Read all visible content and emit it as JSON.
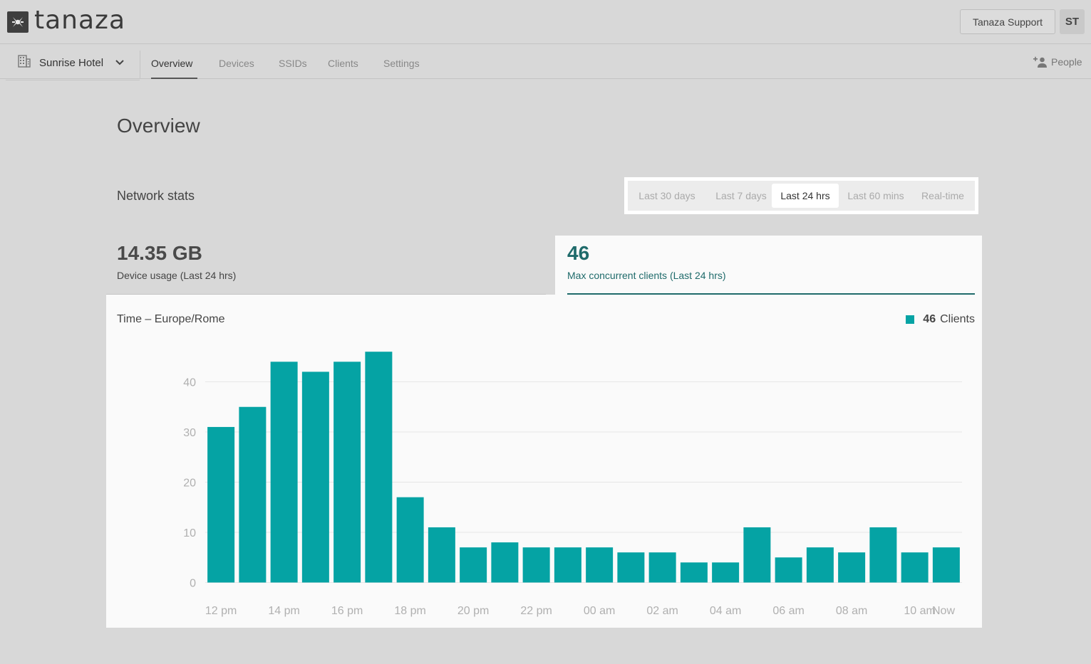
{
  "header": {
    "logo_text": "tanaza",
    "support_label": "Tanaza Support",
    "avatar_initials": "ST"
  },
  "nav": {
    "site_name": "Sunrise Hotel",
    "tabs": [
      {
        "label": "Overview",
        "active": true
      },
      {
        "label": "Devices",
        "active": false
      },
      {
        "label": "SSIDs",
        "active": false
      },
      {
        "label": "Clients",
        "active": false
      },
      {
        "label": "Settings",
        "active": false
      }
    ],
    "people_label": "People"
  },
  "page": {
    "title": "Overview",
    "section_title": "Network stats"
  },
  "range": {
    "options": [
      "Last 30 days",
      "Last 7 days",
      "Last 24 hrs",
      "Last 60 mins",
      "Real-time"
    ],
    "selected": "Last 24 hrs"
  },
  "stats": {
    "usage_value": "14.35 GB",
    "usage_label": "Device usage (Last 24 hrs)",
    "clients_value": "46",
    "clients_label": "Max concurrent clients (Last 24 hrs)"
  },
  "chart": {
    "timezone_label": "Time – Europe/Rome",
    "legend_count": "46",
    "legend_label": "Clients"
  },
  "colors": {
    "bar": "#05a3a4",
    "accent": "#1f6b6b"
  },
  "chart_data": {
    "type": "bar",
    "series": [
      {
        "name": "Clients",
        "values": [
          31,
          35,
          44,
          42,
          44,
          46,
          17,
          11,
          7,
          8,
          7,
          7,
          7,
          6,
          6,
          4,
          4,
          11,
          5,
          7,
          6,
          11,
          6,
          7
        ]
      }
    ],
    "x_tick_labels": [
      "12 pm",
      "14 pm",
      "16 pm",
      "18 pm",
      "20 pm",
      "22 pm",
      "00 am",
      "02 am",
      "04 am",
      "06 am",
      "08 am",
      "10 am",
      "Now"
    ],
    "y_ticks": [
      0,
      10,
      20,
      30,
      40
    ],
    "ylim": [
      0,
      46
    ],
    "grid": true,
    "legend_position": "top-right"
  }
}
